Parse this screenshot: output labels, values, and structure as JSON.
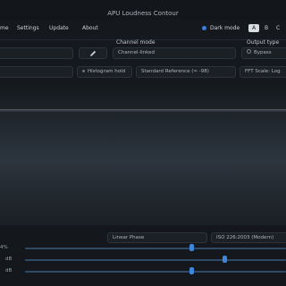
{
  "window": {
    "title": "APU Loudness Contour"
  },
  "menu": {
    "items": [
      "me",
      "Settings",
      "Update",
      "About"
    ],
    "dark_mode_label": "Dark mode",
    "lang_buttons": [
      "A",
      "B",
      "C"
    ]
  },
  "controls": {
    "channel_mode_label": "Channel mode",
    "channel_mode_value": "Channel-linked",
    "output_type_label": "Output type",
    "output_type_value": "Bypass",
    "pencil_icon": "pencil-icon"
  },
  "toolbar": {
    "histogram_hold": "Histogram hold",
    "reference_value": "Standard Reference (≈ -98)",
    "fft_scale": "FFT Scale: Log"
  },
  "bottom": {
    "phase_value": "Linear Phase",
    "standard_value": "ISO 226:2003 (Modern)",
    "row_labels": [
      "4%",
      "dB",
      "dB"
    ],
    "slider_positions": [
      0.75,
      0.8,
      0.75
    ],
    "colors": {
      "accent": "#3d86d9",
      "track": "#2e4a66"
    }
  }
}
